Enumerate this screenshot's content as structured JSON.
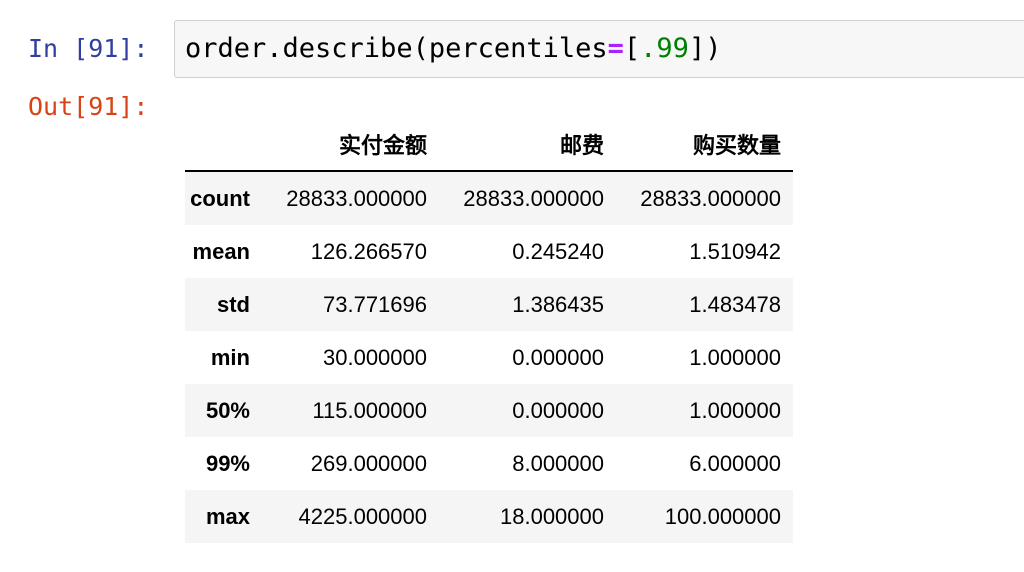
{
  "cell": {
    "in_prompt": "In [91]:",
    "out_prompt": "Out[91]:",
    "code": {
      "part1": "order.describe(percentiles",
      "op": "=",
      "part2": "[",
      "num": ".99",
      "part3": "])"
    }
  },
  "output_table": {
    "columns": [
      "",
      "实付金额",
      "邮费",
      "购买数量"
    ],
    "rows": [
      {
        "label": "count",
        "values": [
          "28833.000000",
          "28833.000000",
          "28833.000000"
        ]
      },
      {
        "label": "mean",
        "values": [
          "126.266570",
          "0.245240",
          "1.510942"
        ]
      },
      {
        "label": "std",
        "values": [
          "73.771696",
          "1.386435",
          "1.483478"
        ]
      },
      {
        "label": "min",
        "values": [
          "30.000000",
          "0.000000",
          "1.000000"
        ]
      },
      {
        "label": "50%",
        "values": [
          "115.000000",
          "0.000000",
          "1.000000"
        ]
      },
      {
        "label": "99%",
        "values": [
          "269.000000",
          "8.000000",
          "6.000000"
        ]
      },
      {
        "label": "max",
        "values": [
          "4225.000000",
          "18.000000",
          "100.000000"
        ]
      }
    ]
  },
  "colors": {
    "in_prompt": "#303f9f",
    "out_prompt": "#d84315",
    "keyword_operator": "#aa22ff",
    "number": "#008000",
    "striped_row": "#f5f5f5"
  }
}
